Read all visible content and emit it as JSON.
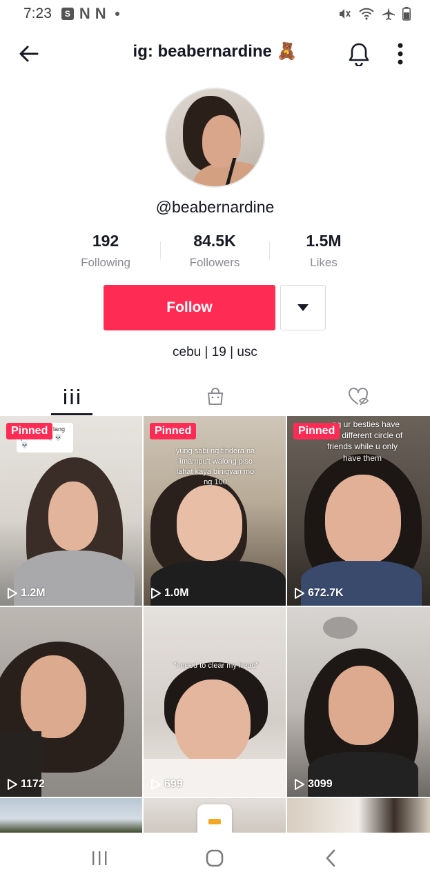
{
  "status_bar": {
    "time": "7:23",
    "left_icons": [
      "shop-icon",
      "n-icon",
      "n-icon",
      "dot-icon"
    ],
    "right_icons": [
      "mute-icon",
      "wifi-icon",
      "airplane-icon",
      "battery-icon"
    ]
  },
  "header": {
    "title": "ig: beabernardine 🧸"
  },
  "profile": {
    "username": "@beabernardine",
    "stats": [
      {
        "value": "192",
        "label": "Following"
      },
      {
        "value": "84.5K",
        "label": "Followers"
      },
      {
        "value": "1.5M",
        "label": "Likes"
      }
    ],
    "follow_label": "Follow",
    "bio": "cebu | 19 | usc"
  },
  "tabs": [
    {
      "icon": "grid-icon",
      "active": true
    },
    {
      "icon": "shop-bag-icon",
      "active": false
    },
    {
      "icon": "liked-hidden-icon",
      "active": false
    }
  ],
  "videos": [
    {
      "pinned": "Pinned",
      "views": "1.2M",
      "caption": "y na ganda lang puhunan 💀💀💀"
    },
    {
      "pinned": "Pinned",
      "views": "1.0M",
      "caption": "yung sabi ng tindera na limampu't walong piso lahat kaya binigyan mo ng 100"
    },
    {
      "pinned": "Pinned",
      "views": "672.7K",
      "caption": "...ng ur besties have ...wn different circle of friends while u only have them"
    },
    {
      "pinned": "",
      "views": "1172",
      "caption": ""
    },
    {
      "pinned": "",
      "views": "699",
      "caption": "\"I need to clear my head\""
    },
    {
      "pinned": "",
      "views": "3099",
      "caption": ""
    }
  ],
  "colors": {
    "accent": "#fe2c55",
    "text_primary": "#161823",
    "text_secondary": "#8a8b91"
  }
}
